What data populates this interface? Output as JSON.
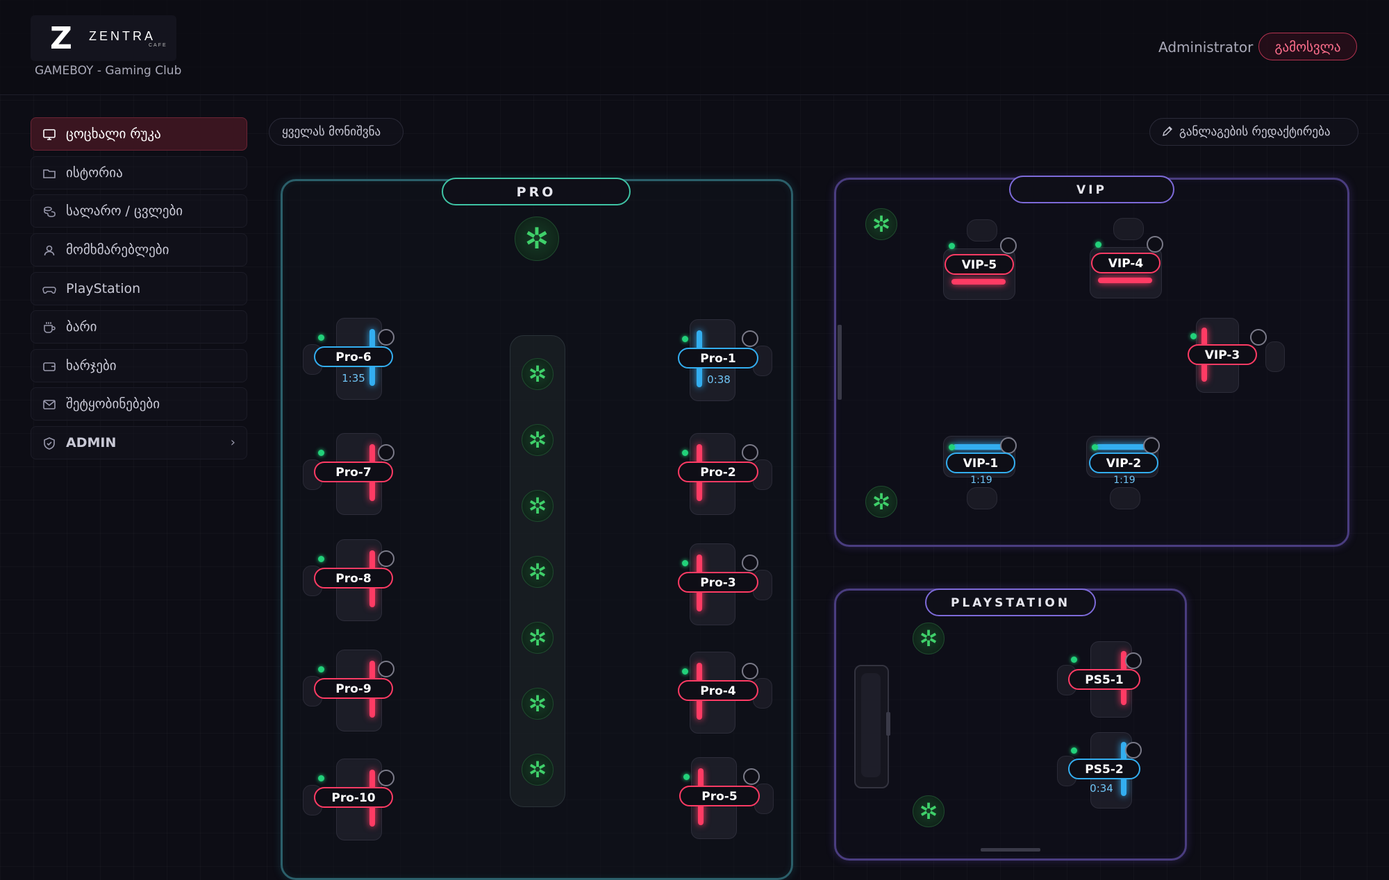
{
  "header": {
    "brand": "ZENTRA",
    "brand_sub": "CAFE",
    "club_name": "GAMEBOY - Gaming Club",
    "user": "Administrator",
    "logout_label": "გამოსვლა"
  },
  "sidebar": {
    "items": [
      {
        "label": "ცოცხალი რუკა",
        "icon": "monitor-icon",
        "active": true
      },
      {
        "label": "ისტორია",
        "icon": "folder-icon"
      },
      {
        "label": "სალარო / ცვლები",
        "icon": "coins-icon"
      },
      {
        "label": "მომხმარებლები",
        "icon": "user-icon"
      },
      {
        "label": "PlayStation",
        "icon": "gamepad-icon"
      },
      {
        "label": "ბარი",
        "icon": "cup-icon"
      },
      {
        "label": "ხარჯები",
        "icon": "wallet-icon"
      },
      {
        "label": "შეტყობინებები",
        "icon": "mail-icon"
      },
      {
        "label": "ADMIN",
        "icon": "shield-icon"
      }
    ]
  },
  "toolbar": {
    "select_all_label": "ყველას მონიშვნა",
    "edit_layout_label": "განლაგების რედაქტირება"
  },
  "zones": {
    "pro": "PRO",
    "vip": "VIP",
    "playstation": "PLAYSTATION"
  },
  "stations": {
    "pro6": {
      "label": "Pro-6",
      "time": "1:35",
      "status": "active"
    },
    "pro7": {
      "label": "Pro-7",
      "status": "free"
    },
    "pro8": {
      "label": "Pro-8",
      "status": "free"
    },
    "pro9": {
      "label": "Pro-9",
      "status": "free"
    },
    "pro10": {
      "label": "Pro-10",
      "status": "free"
    },
    "pro1": {
      "label": "Pro-1",
      "time": "0:38",
      "status": "active"
    },
    "pro2": {
      "label": "Pro-2",
      "status": "free"
    },
    "pro3": {
      "label": "Pro-3",
      "status": "free"
    },
    "pro4": {
      "label": "Pro-4",
      "status": "free"
    },
    "pro5": {
      "label": "Pro-5",
      "status": "free"
    },
    "vip5": {
      "label": "VIP-5",
      "status": "free"
    },
    "vip4": {
      "label": "VIP-4",
      "status": "free"
    },
    "vip3": {
      "label": "VIP-3",
      "status": "free"
    },
    "vip1": {
      "label": "VIP-1",
      "time": "1:19",
      "status": "active"
    },
    "vip2": {
      "label": "VIP-2",
      "time": "1:19",
      "status": "active"
    },
    "ps51": {
      "label": "PS5-1",
      "status": "free"
    },
    "ps52": {
      "label": "PS5-2",
      "time": "0:34",
      "status": "active"
    }
  },
  "colors": {
    "free": "#ff3b64",
    "active": "#33aef0",
    "online_dot": "#22d17a",
    "pro_border": "#2b5f6a",
    "vip_border": "#4a3d80"
  }
}
